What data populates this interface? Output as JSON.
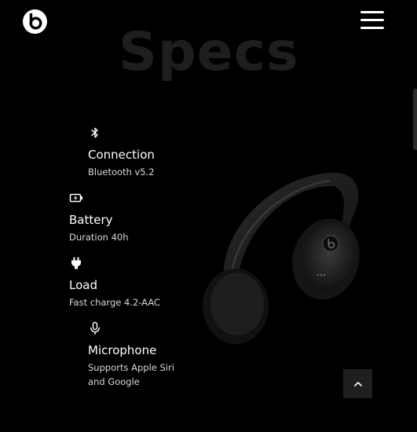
{
  "header": {
    "logo_icon": "beats-logo-icon",
    "menu_icon": "hamburger-menu-icon"
  },
  "section": {
    "title": "Specs"
  },
  "specs": [
    {
      "icon": "bluetooth-icon",
      "name": "Connection",
      "desc": "Bluetooth v5.2"
    },
    {
      "icon": "battery-charging-icon",
      "name": "Battery",
      "desc": "Duration 40h"
    },
    {
      "icon": "plug-icon",
      "name": "Load",
      "desc": "Fast charge 4.2-AAC"
    },
    {
      "icon": "microphone-icon",
      "name": "Microphone",
      "desc": "Supports Apple Siri and Google"
    }
  ],
  "scroll_to_top": {
    "icon": "chevron-up-icon"
  },
  "colors": {
    "background": "#000000",
    "title": "#1e1e1e",
    "text": "#ffffff",
    "button_bg": "#1f1f1f"
  }
}
